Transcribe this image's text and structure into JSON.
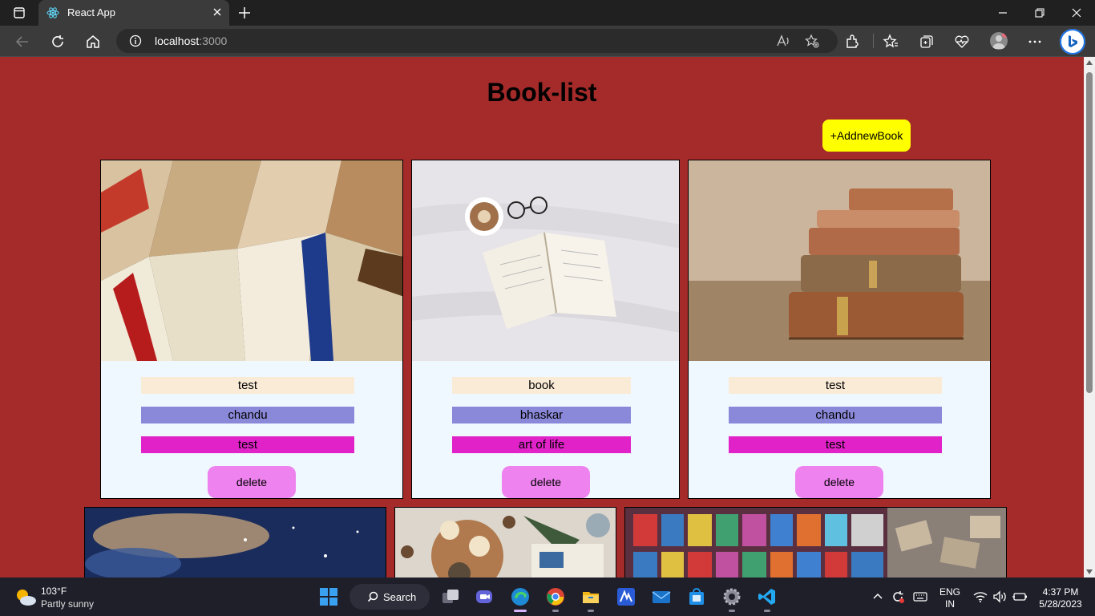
{
  "browser": {
    "tab_title": "React App",
    "url_host": "localhost",
    "url_port": ":3000"
  },
  "page": {
    "title": "Book-list",
    "add_button_label": "+AddnewBook"
  },
  "books": [
    {
      "title": "test",
      "author": "chandu",
      "description": "test",
      "delete_label": "delete"
    },
    {
      "title": "book",
      "author": "bhaskar",
      "description": "art of life",
      "delete_label": "delete"
    },
    {
      "title": "test",
      "author": "chandu",
      "description": "test",
      "delete_label": "delete"
    }
  ],
  "taskbar": {
    "weather_temp": "103°F",
    "weather_condition": "Partly sunny",
    "search_label": "Search",
    "language": "ENG",
    "region": "IN",
    "time": "4:37 PM",
    "date": "5/28/2023"
  },
  "colors": {
    "page_background": "#a52a2a",
    "add_button": "#ffff00",
    "card_background": "#f0f8ff",
    "title_field": "#faebd7",
    "author_field": "#8a88d8",
    "description_field": "#e022c8",
    "delete_button": "#ee82ee"
  }
}
